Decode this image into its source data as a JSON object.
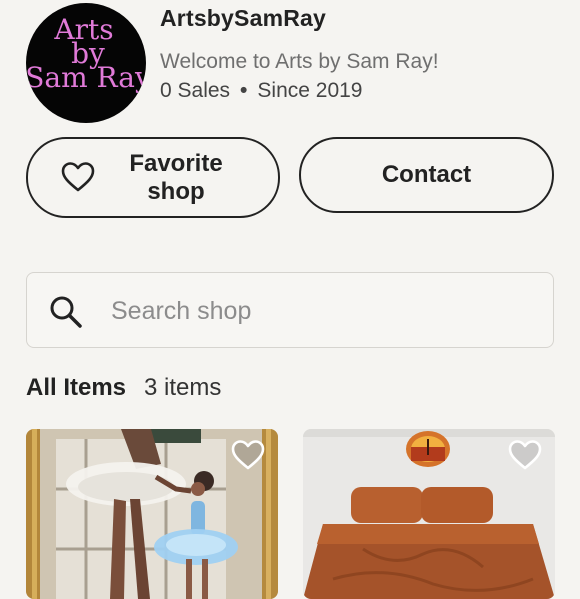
{
  "shop": {
    "logo_text": "Arts by Sam Ray",
    "name": "ArtsbySamRay",
    "welcome": "Welcome to Arts by Sam Ray!",
    "sales": "0 Sales",
    "separator": "•",
    "since": "Since 2019"
  },
  "actions": {
    "favorite_label": "Favorite shop",
    "contact_label": "Contact"
  },
  "search": {
    "placeholder": "Search shop",
    "value": ""
  },
  "items": {
    "heading": "All Items",
    "count": "3 items"
  },
  "listings": [
    {
      "image": "ballet-dancer-painting",
      "favorited": false
    },
    {
      "image": "terracotta-bedding-photo",
      "favorited": false
    }
  ],
  "colors": {
    "background": "#f5f4f1",
    "logo_bg": "#050505",
    "logo_text": "#e07ad8",
    "text_primary": "#222222",
    "text_muted": "#6f6f6f"
  },
  "icons": {
    "favorite": "heart-outline-icon",
    "search": "magnifier-icon",
    "listing_favorite": "heart-outline-icon"
  }
}
